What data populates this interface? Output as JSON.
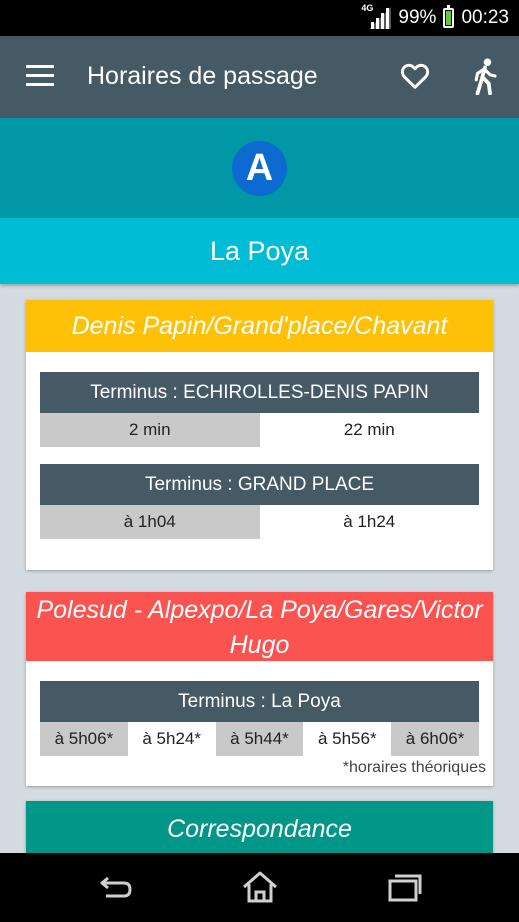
{
  "status_bar": {
    "network": "4G",
    "battery": "99%",
    "time": "00:23",
    "battery_level": 0.99
  },
  "app_bar": {
    "title": "Horaires de passage",
    "icons": [
      "menu-icon",
      "heart-icon",
      "walk-icon"
    ]
  },
  "line": {
    "letter": "A",
    "badge_color": "#0d6ad0"
  },
  "stop": {
    "name": "La Poya"
  },
  "cards": [
    {
      "header": "Denis Papin/Grand'place/Chavant",
      "header_color": "#ffc107",
      "terminus": [
        {
          "label": "Terminus : ECHIROLLES-DENIS PAPIN",
          "times": [
            "2 min",
            "22 min"
          ]
        },
        {
          "label": "Terminus : GRAND PLACE",
          "times": [
            "à 1h04",
            "à 1h24"
          ]
        }
      ]
    },
    {
      "header_line1": "Polesud - Alpexpo/La Poya/Gares/Victor",
      "header_line2": "Hugo",
      "header_color": "#fb5350",
      "terminus": [
        {
          "label": "Terminus : La Poya",
          "times": [
            "à 5h06*",
            "à 5h24*",
            "à 5h44*",
            "à 5h56*",
            "à 6h06*"
          ]
        }
      ],
      "note": "*horaires théoriques"
    },
    {
      "header": "Correspondance",
      "header_color": "#009688"
    }
  ],
  "nav_bar": {
    "icons": [
      "back-icon",
      "home-icon",
      "recents-icon"
    ]
  }
}
